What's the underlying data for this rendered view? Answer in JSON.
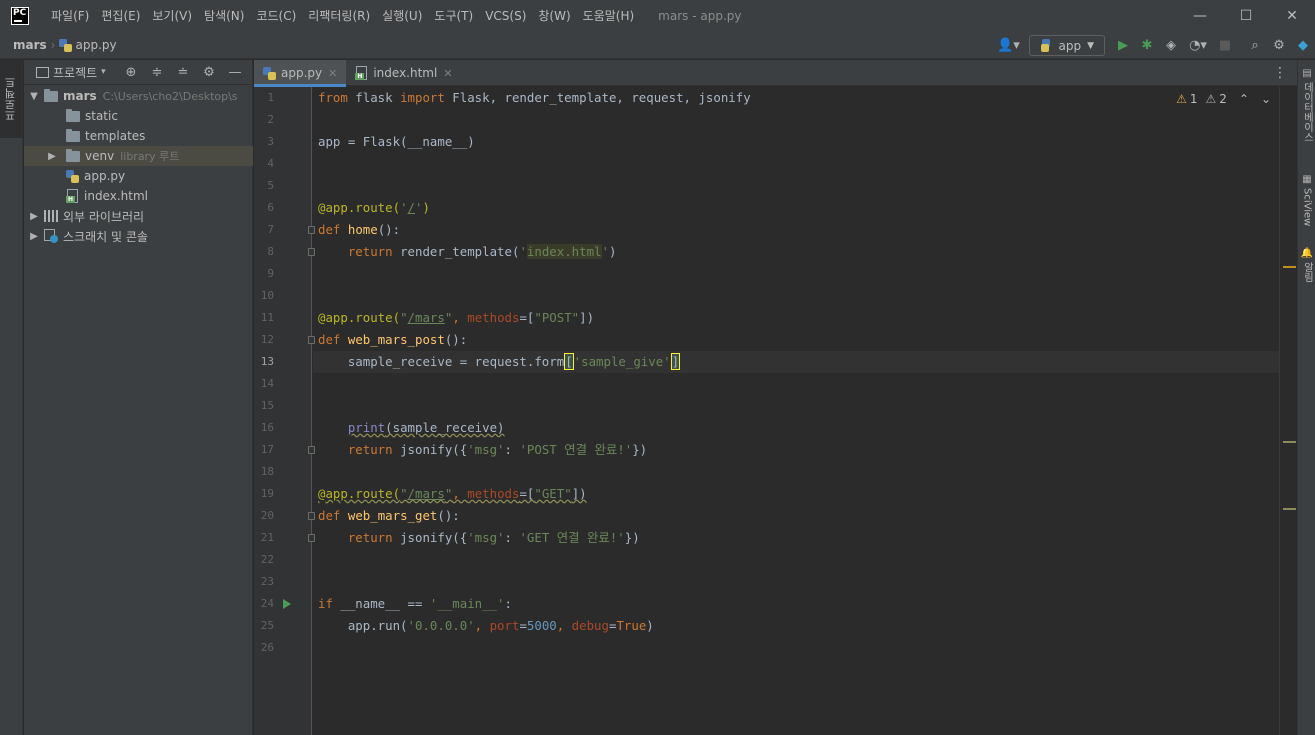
{
  "titlebar": {
    "menu": [
      "파일(F)",
      "편집(E)",
      "보기(V)",
      "탐색(N)",
      "코드(C)",
      "리팩터링(R)",
      "실행(U)",
      "도구(T)",
      "VCS(S)",
      "창(W)",
      "도움말(H)"
    ],
    "window_title": "mars - app.py",
    "minimize_glyph": "—",
    "maximize_glyph": "☐",
    "close_glyph": "✕"
  },
  "navbar": {
    "breadcrumb_project": "mars",
    "breadcrumb_file": "app.py",
    "run_config": "app"
  },
  "left_stripe": {
    "project_tab": "프로젝트"
  },
  "project_panel": {
    "title": "프로젝트",
    "tree": {
      "root_name": "mars",
      "root_path": "C:\\Users\\cho2\\Desktop\\s",
      "static": "static",
      "templates": "templates",
      "venv": "venv",
      "venv_note": "library 루트",
      "app_py": "app.py",
      "index_html": "index.html",
      "external_libs": "외부 라이브러리",
      "scratches": "스크래치 및 콘솔"
    }
  },
  "editor_tabs": [
    {
      "label": "app.py",
      "active": true
    },
    {
      "label": "index.html",
      "active": false
    }
  ],
  "inspections": {
    "warnings": "1",
    "weak_warnings": "2"
  },
  "editor": {
    "current_line": 13,
    "line_numbers": [
      "1",
      "2",
      "3",
      "4",
      "5",
      "6",
      "7",
      "8",
      "9",
      "10",
      "11",
      "12",
      "13",
      "14",
      "15",
      "16",
      "17",
      "18",
      "19",
      "20",
      "21",
      "22",
      "23",
      "24",
      "25",
      "26"
    ],
    "code": {
      "l1": {
        "from": "from",
        "mod": " flask ",
        "imp": "import",
        "rest": " Flask, render_template, request, jsonify"
      },
      "l3": "app = Flask(__name__)",
      "l6": {
        "dec": "@app.route(",
        "q1": "'",
        "path": "/",
        "q2": "'",
        "close": ")"
      },
      "l7": {
        "def": "def",
        "sp": " ",
        "name": "home",
        "rest": "():"
      },
      "l8": {
        "ret": "return",
        "call": " render_template(",
        "q1": "'",
        "val": "index.html",
        "q2": "'",
        "close": ")"
      },
      "l11": {
        "dec": "@app.route(",
        "q1": "\"",
        "path": "/mars",
        "q2": "\"",
        "comma": ", ",
        "kw": "methods",
        "eq": "=[",
        "val": "\"POST\"",
        "close": "])"
      },
      "l12": {
        "def": "def",
        "sp": " ",
        "name": "web_mars_post",
        "rest": "():"
      },
      "l13": {
        "lhs": "sample_receive = request.form",
        "ob": "[",
        "val": "'sample_give'",
        "cb": "]"
      },
      "l16": {
        "fn": "print",
        "rest": "(sample_receive)"
      },
      "l17": {
        "ret": "return",
        "call": " jsonify({",
        "k": "'msg'",
        "colon": ": ",
        "v": "'POST 연결 완료!'",
        "close": "})"
      },
      "l19": {
        "dec": "@app.route(",
        "q1": "\"",
        "path": "/mars",
        "q2": "\"",
        "comma": ", ",
        "kw": "methods",
        "eq": "=[",
        "val": "\"GET\"",
        "close": "])"
      },
      "l20": {
        "def": "def",
        "sp": " ",
        "name": "web_mars_get",
        "rest": "():"
      },
      "l21": {
        "ret": "return",
        "call": " jsonify({",
        "k": "'msg'",
        "colon": ": ",
        "v": "'GET 연결 완료!'",
        "close": "})"
      },
      "l24": {
        "if": "if",
        "mid": " __name__ == ",
        "val": "'__main__'",
        "close": ":"
      },
      "l25": {
        "call": "app.run(",
        "host": "'0.0.0.0'",
        "c1": ", ",
        "port_kw": "port",
        "eq1": "=",
        "port": "5000",
        "c2": ", ",
        "debug_kw": "debug",
        "eq2": "=",
        "debug": "True",
        "close": ")"
      }
    }
  },
  "right_stripe": {
    "database": "데이터베이스",
    "sciview": "SciView",
    "notifications": "알림"
  },
  "colors": {
    "accent": "#4a88c7",
    "keyword": "#cc7832",
    "string": "#6a8759",
    "decorator": "#bbb529",
    "number": "#6897bb",
    "warning": "#e0a843"
  }
}
